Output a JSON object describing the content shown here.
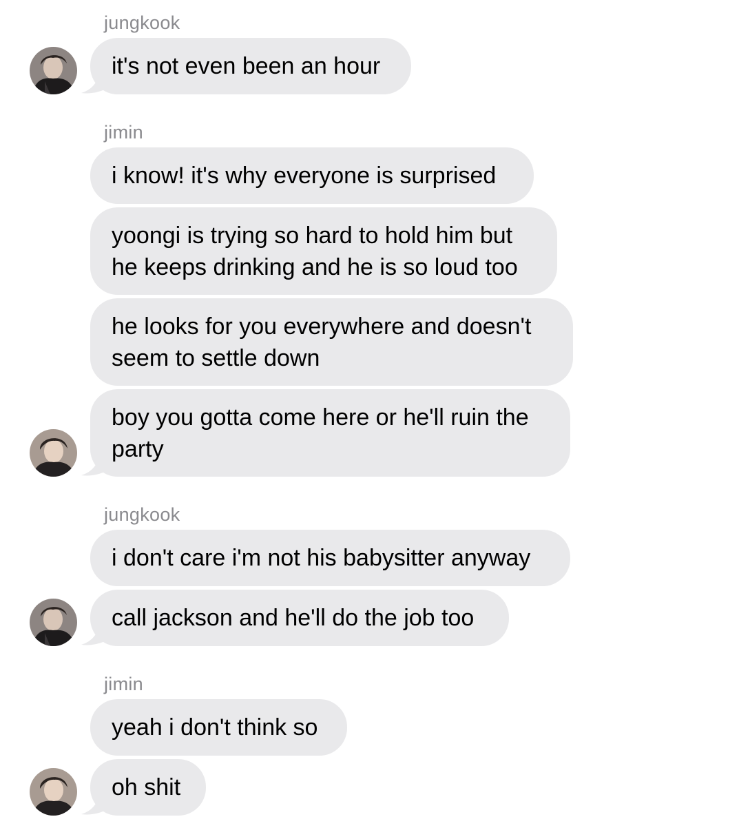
{
  "colors": {
    "bubble": "#e9e9eb",
    "sender_text": "#8a8a8e",
    "message_text": "#000000",
    "background": "#ffffff"
  },
  "senders": {
    "s1": "jungkook",
    "s2": "jimin",
    "s3": "jungkook",
    "s4": "jimin"
  },
  "messages": {
    "m1": "it's not even been an hour",
    "m2": "i know! it's why everyone is surprised",
    "m3": "yoongi is trying so hard to hold him but\nhe keeps drinking and he is so loud too",
    "m4": "he looks for you everywhere and doesn't\nseem to settle down",
    "m5": "boy you gotta come here or he'll ruin the\nparty",
    "m6": "i don't care i'm not his babysitter anyway",
    "m7": "call jackson and he'll do the job too",
    "m8": "yeah i don't think so",
    "m9": "oh shit"
  },
  "avatars": {
    "a1": "jungkook-avatar",
    "a2": "jimin-avatar",
    "a3": "jungkook-avatar",
    "a4": "jimin-avatar"
  }
}
